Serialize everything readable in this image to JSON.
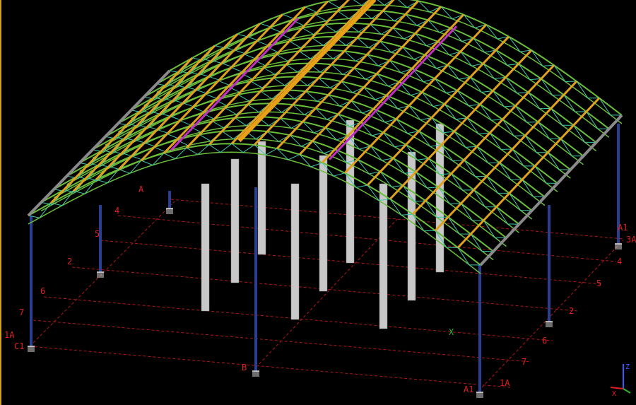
{
  "colors": {
    "background": "#000000",
    "grid_line": "#b01818",
    "grid_label": "#e02020",
    "column": "#2a3f8f",
    "pier": "#c8c8c8",
    "arch_chord": "#6abf3a",
    "truss_web": "#3fc9b0",
    "purlin": "#e0a020",
    "bracing": "#c030c0",
    "edge_beam": "#8a8a8a",
    "frame_border": "#c9a227"
  },
  "grid_labels": {
    "g1A_left": "1A",
    "gC1": "C1",
    "g7_left": "7",
    "g6_left": "6",
    "g2_left": "2",
    "g5_left": "5",
    "g4_left": "4",
    "gB": "B",
    "gA1_bottom": "A1",
    "g1A_right": "1A",
    "g7_right": "7",
    "g6_right": "6",
    "g2_right": "2",
    "g5_right": "5",
    "g4_right": "4",
    "g3A": "3A",
    "gA1_right": "A1",
    "gA_mid": "A",
    "origin_x": "X"
  },
  "axis_triad": {
    "x": "X",
    "z": "Z"
  }
}
